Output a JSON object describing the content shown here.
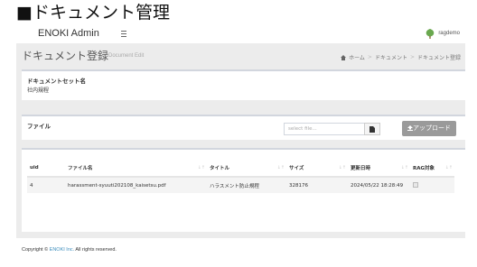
{
  "caption": "■ドキュメント管理",
  "topbar": {
    "brand": "ENOKI Admin",
    "user_name": "ragdemo",
    "colors": {
      "user_icon": "#6aa84f"
    }
  },
  "header": {
    "title": "ドキュメント登録",
    "subtitle": "Document Edit",
    "breadcrumb": [
      "ホーム",
      "ドキュメント",
      "ドキュメント登録"
    ]
  },
  "docset": {
    "label": "ドキュメントセット名",
    "value": "社内規程"
  },
  "file_panel": {
    "label": "ファイル",
    "placeholder": "select file...",
    "upload_label": "アップロード",
    "colors": {
      "upload_button": "#9a9a9a"
    }
  },
  "table": {
    "headers": [
      "uid",
      "ファイル名",
      "タイトル",
      "サイズ",
      "更新日時",
      "RAG対象"
    ],
    "rows": [
      {
        "uid": "4",
        "filename": "harassment-syuuti202108_kaisetsu.pdf",
        "title": "ハラスメント防止規程",
        "size": "328176",
        "updated": "2024/05/22 18:28:49"
      }
    ]
  },
  "footer": {
    "text": "Copyright © ",
    "company": "ENOKI Inc.",
    "suffix": " All rights reserved."
  }
}
